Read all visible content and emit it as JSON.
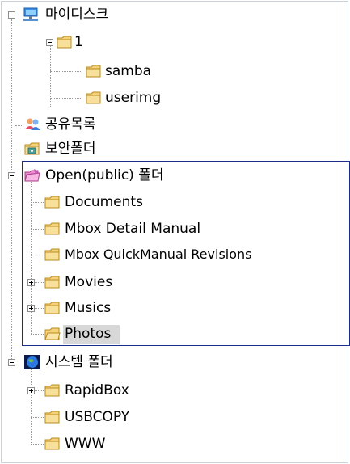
{
  "tree": {
    "root": {
      "label": "마이디스크",
      "icon": "network-computer-icon"
    },
    "folder_1": {
      "label": "1"
    },
    "samba": {
      "label": "samba"
    },
    "userimg": {
      "label": "userimg"
    },
    "shared_list": {
      "label": "공유목록",
      "icon": "users-icon"
    },
    "secure_folder": {
      "label": "보안폴더",
      "icon": "secure-folder-icon"
    },
    "public_folder": {
      "label": "Open(public) 폴더",
      "icon": "open-folder-icon"
    },
    "documents": {
      "label": "Documents"
    },
    "mbox_detail": {
      "label": "Mbox Detail Manual"
    },
    "mbox_quick": {
      "label": "Mbox QuickManual Revisions"
    },
    "movies": {
      "label": "Movies"
    },
    "musics": {
      "label": "Musics"
    },
    "photos": {
      "label": "Photos",
      "selected": true
    },
    "system_folder": {
      "label": "시스템 폴더",
      "icon": "globe-icon"
    },
    "rapidbox": {
      "label": "RapidBox"
    },
    "usbcopy": {
      "label": "USBCOPY"
    },
    "www": {
      "label": "WWW"
    }
  },
  "colors": {
    "folder": "#f3d27a",
    "selection_border": "#1c2a8a",
    "highlight": "#d8d8d8"
  }
}
